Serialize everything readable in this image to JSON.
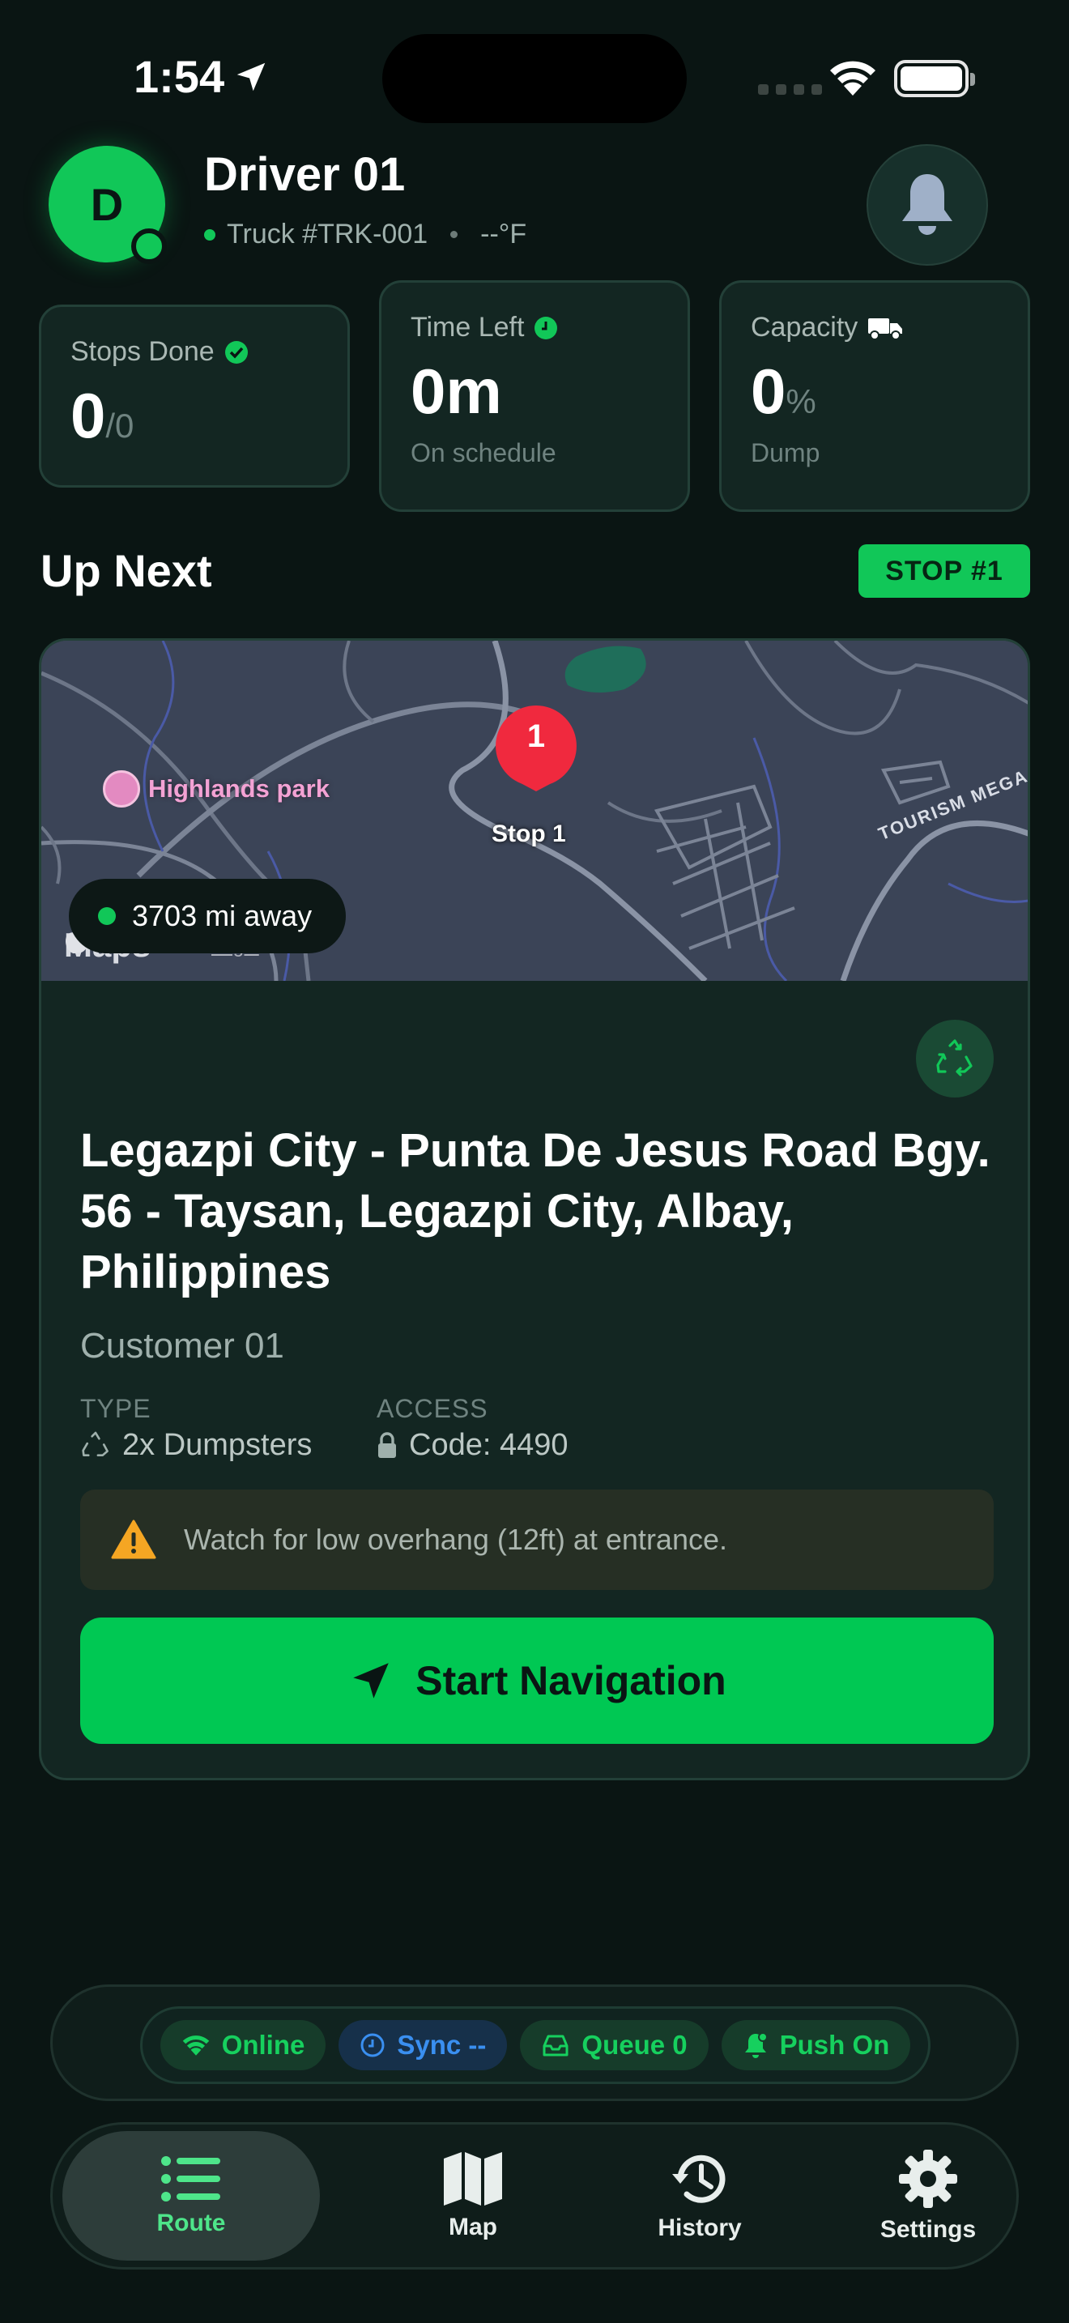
{
  "status_bar": {
    "time": "1:54"
  },
  "driver": {
    "avatar_initial": "D",
    "name": "Driver 01",
    "truck": "Truck #TRK-001",
    "temperature": "--°F"
  },
  "stats": {
    "stops": {
      "label": "Stops Done",
      "value": "0",
      "unit": "/0"
    },
    "time": {
      "label": "Time Left",
      "value": "0m",
      "sub": "On schedule"
    },
    "capacity": {
      "label": "Capacity",
      "value": "0",
      "unit": "%",
      "sub": "Dump"
    }
  },
  "up_next": {
    "heading": "Up Next",
    "badge": "STOP #1"
  },
  "stop_card": {
    "map": {
      "pin_number": "1",
      "pin_label": "Stop 1",
      "park_label": "Highlands park",
      "road_label": "TOURISM MEGA-H",
      "maps_brand": "Maps",
      "legal": "Legal",
      "distance": "3703 mi away"
    },
    "address": "Legazpi City - Punta De Jesus Road Bgy. 56 - Taysan, Legazpi City, Albay, Philippines",
    "customer": "Customer 01",
    "type_label": "TYPE",
    "type_value": "2x Dumpsters",
    "access_label": "ACCESS",
    "access_value": "Code: 4490",
    "warning": "Watch for low overhang (12ft) at entrance.",
    "nav_button": "Start Navigation"
  },
  "connection": {
    "online": "Online",
    "sync": "Sync --",
    "queue": "Queue 0",
    "push": "Push On"
  },
  "tabs": {
    "route": "Route",
    "map": "Map",
    "history": "History",
    "settings": "Settings",
    "active": "route"
  },
  "colors": {
    "accent": "#11c758",
    "background": "#0a1513",
    "card": "#132622",
    "pin": "#f0293e",
    "warning": "#f5a623",
    "sync_blue": "#3a8ff0"
  }
}
